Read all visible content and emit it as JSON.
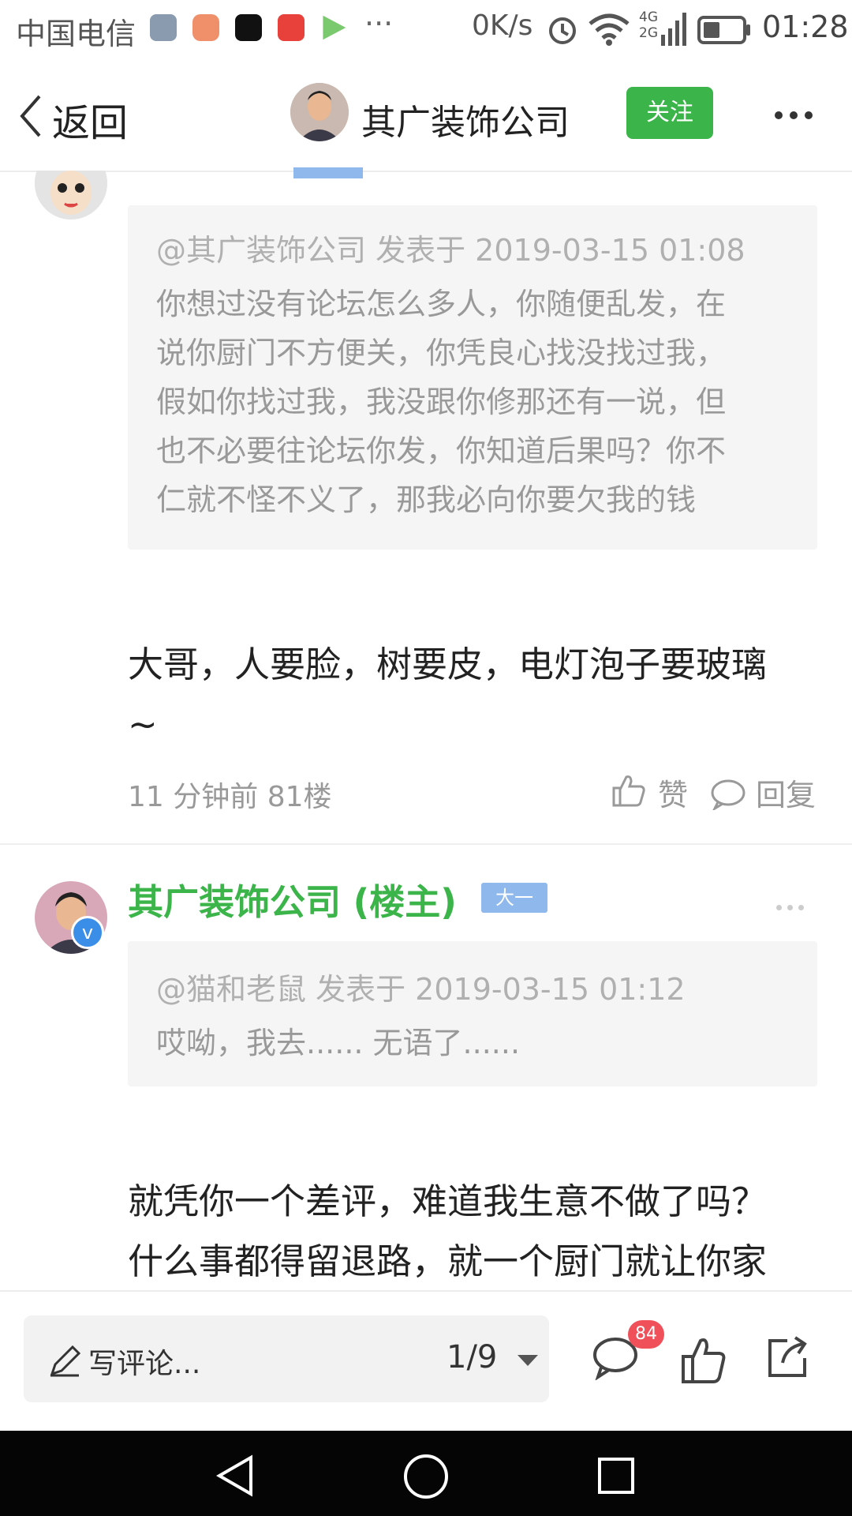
{
  "status_bar": {
    "carrier": "中国电信",
    "app_icons": [
      "gallery-icon",
      "app-icon",
      "tiktok-icon",
      "toutiao-icon",
      "video-icon"
    ],
    "more": "···",
    "speed": "0K/s",
    "network": "4G 2G",
    "time": "01:28"
  },
  "nav": {
    "back_label": "返回",
    "title": "其广装饰公司",
    "follow_label": "关注"
  },
  "post1": {
    "quote_meta": "@其广装饰公司 发表于 2019-03-15 01:08",
    "quote_lines": [
      "你想过没有论坛怎么多人，你随便乱发，在",
      "说你厨门不方便关，你凭良心找没找过我，",
      "假如你找过我，我没跟你修那还有一说，但",
      "也不必要往论坛你发，你知道后果吗？你不",
      "仁就不怪不义了，那我必向你要欠我的钱"
    ],
    "reply_line1": "大哥，人要脸，树要皮，电灯泡子要玻璃",
    "reply_line2": "~",
    "meta": "11 分钟前  81楼",
    "like_label": "赞",
    "reply_label": "回复"
  },
  "post2": {
    "username": "其广装饰公司 (楼主)",
    "level": "大一",
    "quote_meta": "@猫和老鼠 发表于 2019-03-15 01:12",
    "quote_body": "哎呦，我去...... 无语了......",
    "reply_line1": "就凭你一个差评，难道我生意不做了吗？",
    "reply_line2": "什么事都得留退路，就一个厨门就让你家"
  },
  "bottom_bar": {
    "comment_placeholder": "写评论...",
    "page_indicator": "1/9",
    "comment_count": "84"
  },
  "colors": {
    "accent_green": "#3bb44a",
    "badge_red": "#f0505a",
    "level_blue": "#8fb8ec"
  }
}
